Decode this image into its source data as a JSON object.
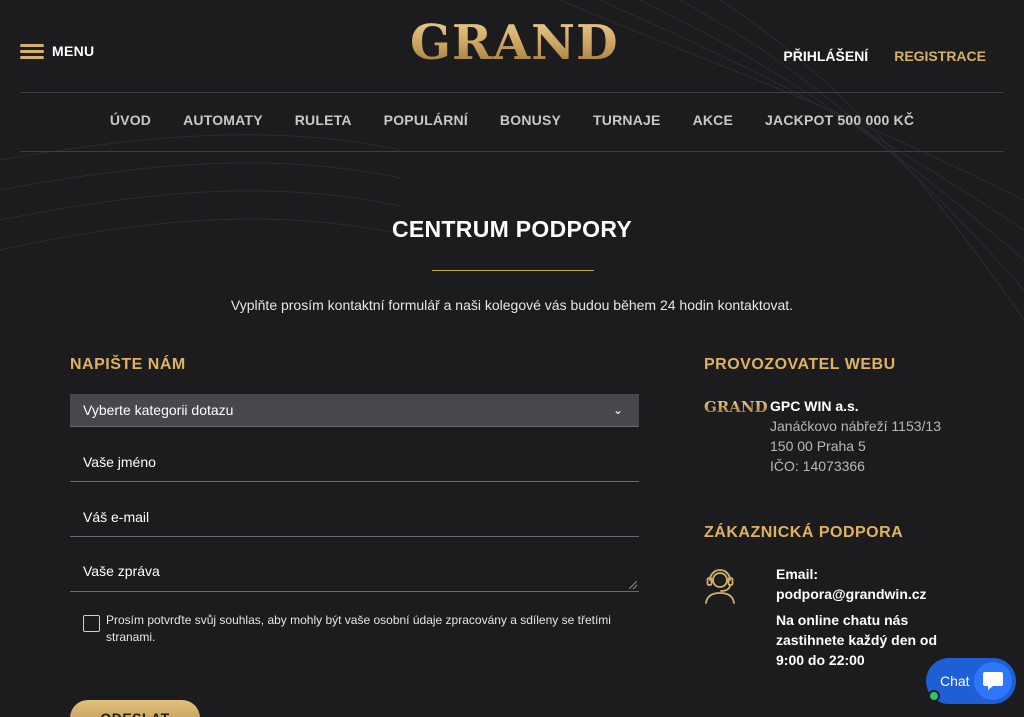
{
  "header": {
    "menu_label": "MENU",
    "logo_text": "GRAND",
    "login_label": "PŘIHLÁŠENÍ",
    "register_label": "REGISTRACE"
  },
  "nav": {
    "items": [
      "ÚVOD",
      "AUTOMATY",
      "RULETA",
      "POPULÁRNÍ",
      "BONUSY",
      "TURNAJE",
      "AKCE",
      "JACKPOT 500 000 KČ"
    ]
  },
  "main": {
    "title": "CENTRUM PODPORY",
    "intro": "Vyplňte prosím kontaktní formulář a naši kolegové vás budou během 24 hodin kontaktovat."
  },
  "form": {
    "heading": "NAPIŠTE NÁM",
    "category_select": "Vyberte kategorii dotazu",
    "name_placeholder": "Vaše jméno",
    "email_placeholder": "Váš e-mail",
    "message_placeholder": "Vaše zpráva",
    "consent_text": "Prosím potvrďte svůj souhlas, aby mohly být vaše osobní údaje zpracovány a sdíleny se třetími stranami.",
    "submit_label": "ODESLAT"
  },
  "operator": {
    "heading": "PROVOZOVATEL WEBU",
    "logo_text": "GRAND",
    "company": "GPC WIN a.s.",
    "street": "Janáčkovo nábřeží 1153/13",
    "city": "150 00 Praha 5",
    "ico": "IČO: 14073366"
  },
  "support": {
    "heading": "ZÁKAZNICKÁ PODPORA",
    "email_label": "Email:",
    "email": "podpora@grandwin.cz",
    "chat_line1": "Na online chatu nás",
    "chat_line2": "zastihnete každý den od",
    "chat_hours": "9:00 do 22:00"
  },
  "chat_widget": {
    "label": "Chat"
  },
  "colors": {
    "background": "#1c1c1f",
    "gold": "#d4b06a",
    "field_bg": "#47474d",
    "chat_blue": "#1f5fd6"
  }
}
